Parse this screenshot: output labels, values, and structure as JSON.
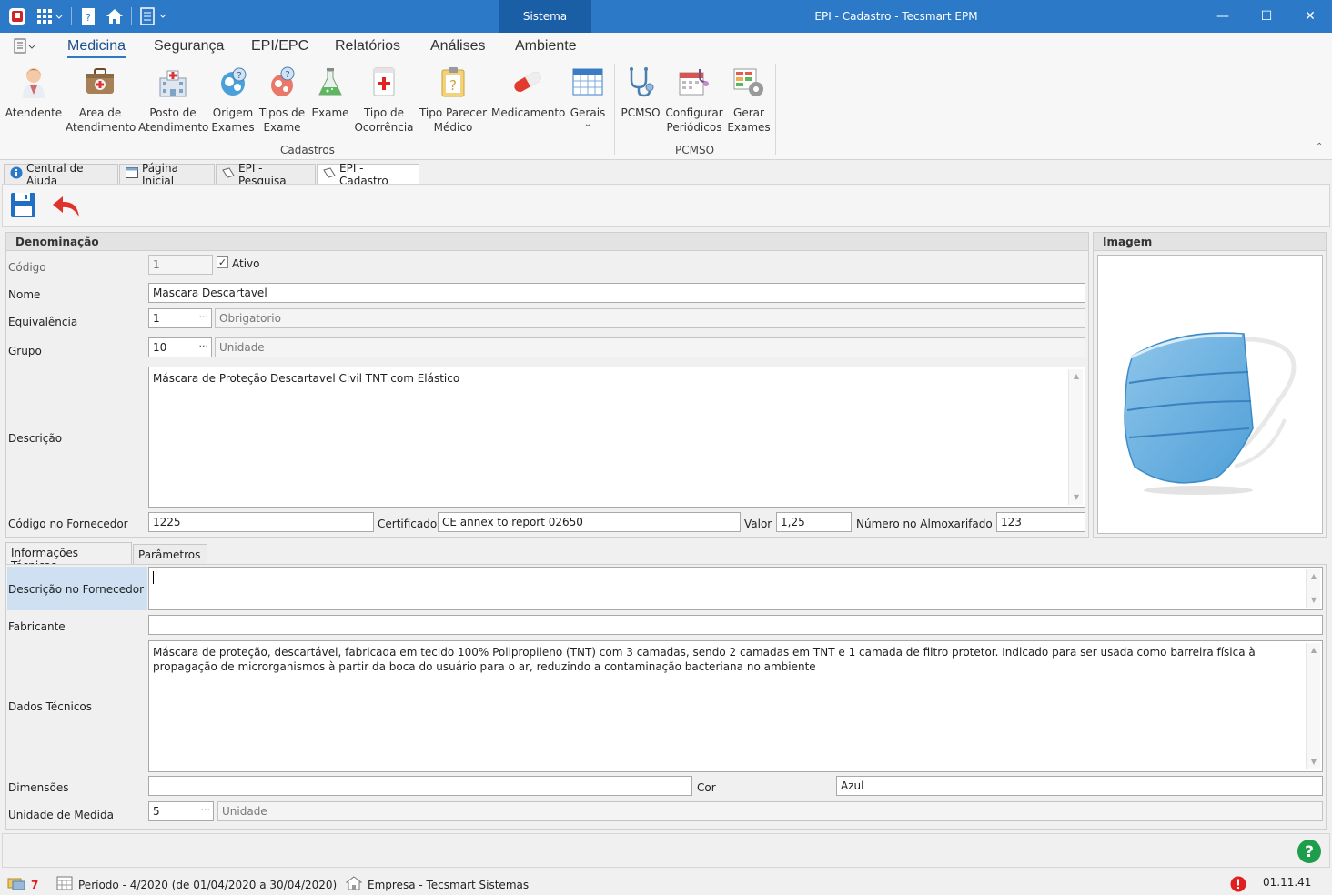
{
  "window": {
    "section_label": "Sistema",
    "title": "EPI - Cadastro - Tecsmart EPM",
    "controls": {
      "minimize": "—",
      "maximize": "☐",
      "close": "✕"
    }
  },
  "menu": {
    "items": [
      "Medicina",
      "Segurança",
      "EPI/EPC",
      "Relatórios",
      "Análises",
      "Ambiente"
    ],
    "active": "Medicina"
  },
  "ribbon": {
    "cadastros": {
      "group_label": "Cadastros",
      "buttons": [
        {
          "label1": "Atendente",
          "label2": "",
          "icon": "receptionist-icon"
        },
        {
          "label1": "Area de",
          "label2": "Atendimento",
          "icon": "medical-bag-icon"
        },
        {
          "label1": "Posto de",
          "label2": "Atendimento",
          "icon": "hospital-icon"
        },
        {
          "label1": "Origem",
          "label2": "Exames",
          "icon": "exam-origin-icon"
        },
        {
          "label1": "Tipos de",
          "label2": "Exame",
          "icon": "exam-types-icon"
        },
        {
          "label1": "Exame",
          "label2": "",
          "icon": "flask-icon"
        },
        {
          "label1": "Tipo de",
          "label2": "Ocorrência",
          "icon": "first-aid-icon"
        },
        {
          "label1": "Tipo Parecer",
          "label2": "Médico",
          "icon": "clipboard-question-icon"
        },
        {
          "label1": "Medicamento",
          "label2": "",
          "icon": "pill-icon"
        },
        {
          "label1": "Gerais",
          "label2": "⌄",
          "icon": "grid-table-icon"
        }
      ]
    },
    "pcmso": {
      "group_label": "PCMSO",
      "buttons": [
        {
          "label1": "PCMSO",
          "label2": "",
          "icon": "stethoscope-icon"
        },
        {
          "label1": "Configurar",
          "label2": "Periódicos",
          "icon": "calendar-stethoscope-icon"
        },
        {
          "label1": "Gerar",
          "label2": "Exames",
          "icon": "generate-exams-icon"
        }
      ]
    }
  },
  "doc_tabs": [
    "Central de Ajuda",
    "Página Inicial",
    "EPI - Pesquisa",
    "EPI - Cadastro"
  ],
  "form": {
    "denominacao": {
      "header": "Denominação",
      "codigo_label": "Código",
      "codigo_value": "1",
      "ativo_label": "Ativo",
      "ativo_checked": true,
      "nome_label": "Nome",
      "nome_value": "Mascara Descartavel",
      "equivalencia_label": "Equivalência",
      "equivalencia_code": "1",
      "equivalencia_desc": "Obrigatorio",
      "grupo_label": "Grupo",
      "grupo_code": "10",
      "grupo_desc": "Unidade",
      "descricao_label": "Descrição",
      "descricao_value": "Máscara de Proteção Descartavel Civil TNT com Elástico",
      "cod_fornecedor_label": "Código no Fornecedor",
      "cod_fornecedor_value": "1225",
      "certificado_label": "Certificado",
      "certificado_value": "CE annex to report 02650",
      "valor_label": "Valor",
      "valor_value": "1,25",
      "num_almox_label": "Número no Almoxarifado",
      "num_almox_value": "123"
    },
    "imagem": {
      "header": "Imagem"
    },
    "subtabs": [
      "Informações Técnicas",
      "Parâmetros"
    ],
    "tecnicas": {
      "desc_fornecedor_label": "Descrição no Fornecedor",
      "desc_fornecedor_value": "",
      "fabricante_label": "Fabricante",
      "fabricante_value": "",
      "dados_tecnicos_label": "Dados Técnicos",
      "dados_tecnicos_value": "Máscara de proteção, descartável, fabricada em tecido 100% Polipropileno (TNT) com 3 camadas, sendo 2 camadas em TNT e 1 camada de filtro protetor. Indicado para ser usada como barreira física à propagação de microrganismos à partir da boca do usuário para o ar, reduzindo a contaminação bacteriana no ambiente",
      "dimensoes_label": "Dimensões",
      "dimensoes_value": "",
      "cor_label": "Cor",
      "cor_value": "Azul",
      "unidade_label": "Unidade de Medida",
      "unidade_code": "5",
      "unidade_desc": "Unidade"
    }
  },
  "status": {
    "notifications": "7",
    "periodo": "Período - 4/2020 (de 01/04/2020 a 30/04/2020)",
    "empresa": "Empresa - Tecsmart Sistemas",
    "version": "01.11.41"
  },
  "colors": {
    "titlebar": "#2b79c7",
    "accent": "#1a5ea5",
    "help_green": "#1e9e4a",
    "alert_red": "#e02020"
  }
}
